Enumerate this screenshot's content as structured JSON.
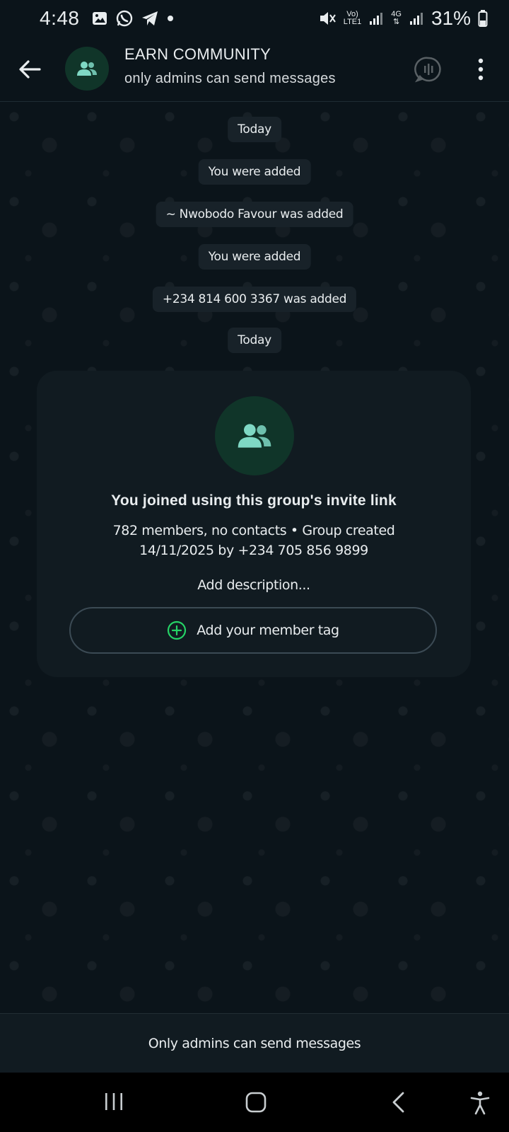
{
  "status_bar": {
    "time": "4:48",
    "network_volte": "Vo)",
    "network_lte": "LTE1",
    "network_4g": "4G",
    "battery": "31%"
  },
  "header": {
    "group_name": "EARN COMMUNITY",
    "subtitle": "only admins can send messages"
  },
  "chat": {
    "system_messages": [
      "Today",
      "You were added",
      "~ Nwobodo Favour was added",
      "You were added",
      "+234 814 600 3367 was added",
      "Today"
    ],
    "info_card": {
      "title": "You joined using this group's invite link",
      "meta_line1": "782 members, no contacts • Group created",
      "meta_line2": "14/11/2025 by +234 705 856 9899",
      "description_prompt": "Add description...",
      "member_tag_button": "Add your member tag"
    }
  },
  "bottom_notice": "Only admins can send messages",
  "colors": {
    "background": "#0b141a",
    "panel": "#111b21",
    "pill": "#182229",
    "accent_green": "#25d366",
    "avatar_bg": "#103529",
    "avatar_icon": "#7fd8c4"
  },
  "icons": {
    "back": "arrow-left-icon",
    "group_avatar": "group-people-icon",
    "call": "voice-chat-icon",
    "menu": "more-vertical-icon",
    "add": "plus-circle-icon",
    "nav_recents": "recents-icon",
    "nav_home": "home-icon",
    "nav_back": "back-chevron-icon",
    "nav_accessibility": "accessibility-icon"
  }
}
